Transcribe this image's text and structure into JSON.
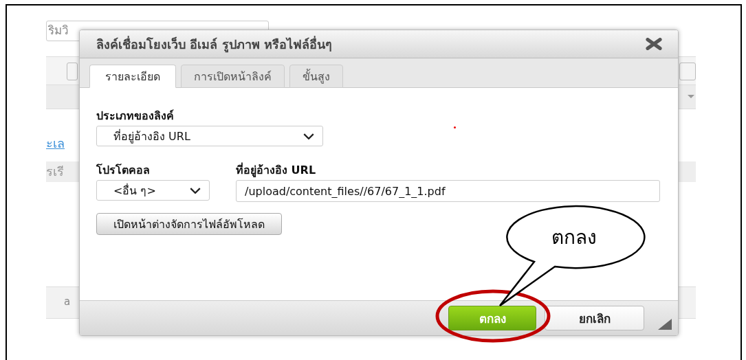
{
  "background": {
    "title_field": "ริมวิ",
    "link": "ะเล",
    "row_text": "รเรี",
    "status_text": "a"
  },
  "dialog": {
    "title": "ลิงค์เชื่อมโยงเว็บ อีเมล์ รูปภาพ หรือไฟล์อื่นๆ",
    "tabs": [
      {
        "label": "รายละเอียด",
        "selected": true
      },
      {
        "label": "การเปิดหน้าลิงค์",
        "selected": false
      },
      {
        "label": "ขั้นสูง",
        "selected": false
      }
    ],
    "link_type": {
      "label": "ประเภทของลิงค์",
      "value": "ที่อยู่อ้างอิง URL"
    },
    "protocol": {
      "label": "โปรโตคอล",
      "value": "<อื่น ๆ>"
    },
    "url": {
      "label": "ที่อยู่อ้างอิง URL",
      "value": "/upload/content_files//67/67_1_1.pdf"
    },
    "browse_button": "เปิดหน้าต่างจัดการไฟล์อัพโหลด",
    "buttons": [
      {
        "label": "ตกลง",
        "kind": "primary"
      },
      {
        "label": "ยกเลิก",
        "kind": "secondary"
      }
    ]
  },
  "callout": {
    "text": "ตกลง"
  }
}
